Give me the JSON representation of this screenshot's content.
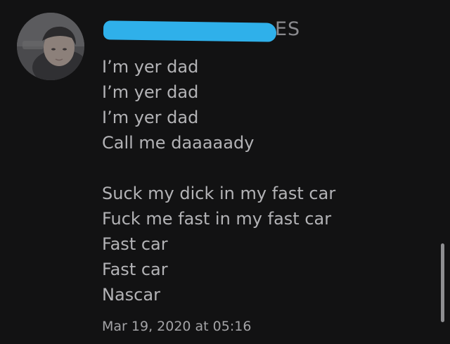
{
  "post": {
    "username": "ES",
    "message_lines": [
      "I’m yer dad",
      "I’m yer dad",
      "I’m yer dad",
      "Call me daaaaady",
      "",
      "Suck my dick in my fast car",
      "Fuck me fast in my fast car",
      "Fast car",
      "Fast car",
      "Nascar"
    ],
    "timestamp": "Mar 19, 2020 at 05:16"
  },
  "colors": {
    "background": "#121213",
    "text": "#b3b3b6",
    "redaction_marker": "#2fb0ea"
  },
  "icons": {
    "avatar": "user-avatar-photo"
  }
}
